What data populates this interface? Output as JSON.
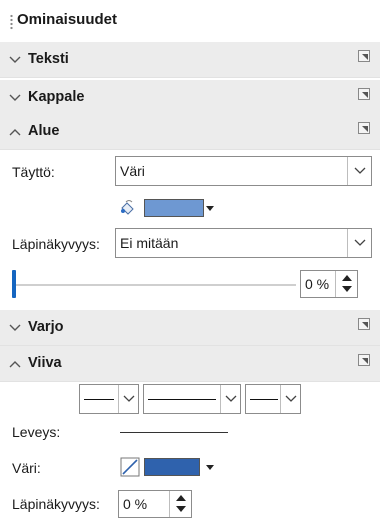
{
  "panel": {
    "title": "Ominaisuudet"
  },
  "sections": {
    "text": {
      "label": "Teksti"
    },
    "paragraph": {
      "label": "Kappale"
    },
    "area": {
      "label": "Alue"
    },
    "shadow": {
      "label": "Varjo"
    },
    "line": {
      "label": "Viiva"
    }
  },
  "area": {
    "fill_label": "Täyttö:",
    "fill_value": "Väri",
    "fill_color": "#6e98d2",
    "transparency_label": "Läpinäkyvyys:",
    "transparency_mode": "Ei mitään",
    "transparency_value": "0 %",
    "transparency_level": 0
  },
  "line": {
    "width_label": "Leveys:",
    "color_label": "Väri:",
    "line_color": "#2f62ad",
    "transparency_label": "Läpinäkyvyys:",
    "transparency_value": "0 %"
  },
  "colors": {
    "accent": "#1565c0",
    "section_bg": "#ececec"
  },
  "icons": {
    "collapsed": "chevron-down-icon",
    "expanded": "chevron-up-icon",
    "more_options": "more-options-icon",
    "fill_color": "paint-bucket-icon",
    "line_color": "pen-line-icon"
  }
}
